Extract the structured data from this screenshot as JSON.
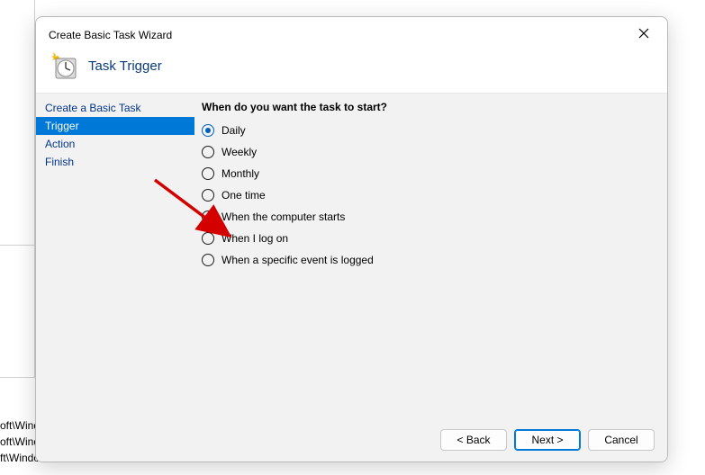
{
  "bg": {
    "line1": "oft\\Wind",
    "line2": "oft\\Windows\\U...",
    "line3": "ft\\Windows\\Eli"
  },
  "dialog": {
    "title": "Create Basic Task Wizard",
    "header_title": "Task Trigger"
  },
  "sidebar": {
    "items": [
      {
        "label": "Create a Basic Task",
        "selected": false
      },
      {
        "label": "Trigger",
        "selected": true
      },
      {
        "label": "Action",
        "selected": false
      },
      {
        "label": "Finish",
        "selected": false
      }
    ]
  },
  "main": {
    "prompt": "When do you want the task to start?",
    "options": [
      {
        "label": "Daily",
        "selected": true
      },
      {
        "label": "Weekly",
        "selected": false
      },
      {
        "label": "Monthly",
        "selected": false
      },
      {
        "label": "One time",
        "selected": false
      },
      {
        "label": "When the computer starts",
        "selected": false
      },
      {
        "label": "When I log on",
        "selected": false
      },
      {
        "label": "When a specific event is logged",
        "selected": false
      }
    ]
  },
  "footer": {
    "back": "< Back",
    "next": "Next >",
    "cancel": "Cancel"
  }
}
